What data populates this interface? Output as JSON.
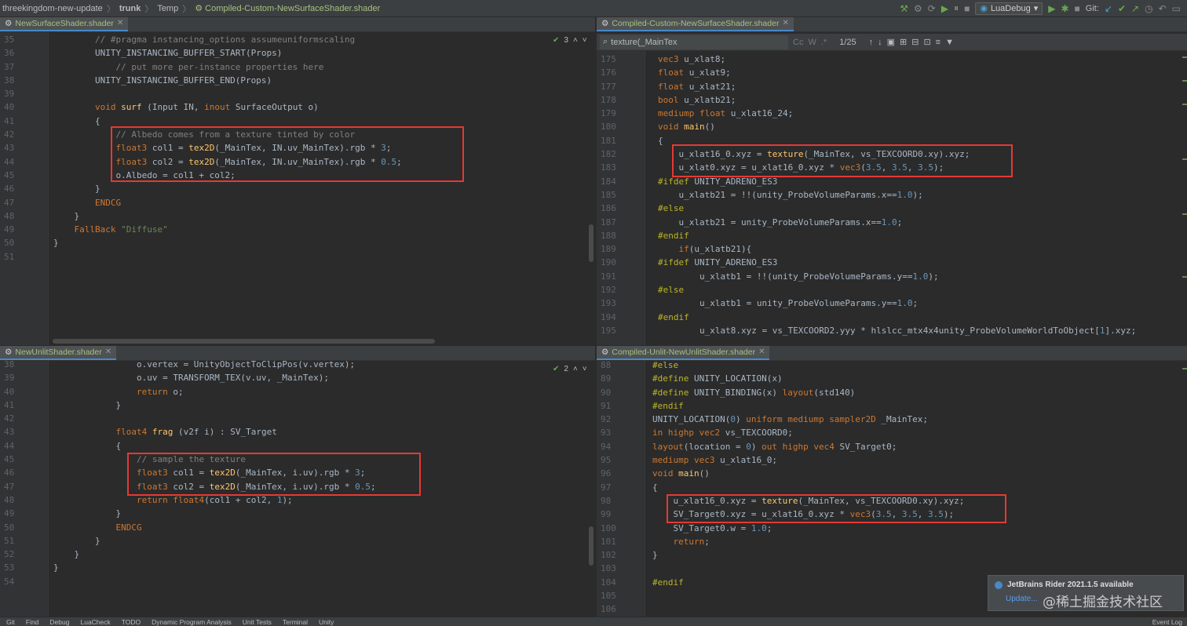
{
  "breadcrumb": [
    "threekingdom-new-update",
    "trunk",
    "Temp",
    "Compiled-Custom-NewSurfaceShader.shader"
  ],
  "toolbar": {
    "run_config": "LuaDebug",
    "git_label": "Git:"
  },
  "panes": {
    "top_left": {
      "tab": "NewSurfaceShader.shader",
      "inspection": "3",
      "lines": [
        {
          "no": "35",
          "code": "        // #pragma instancing_options assumeuniformscaling"
        },
        {
          "no": "36",
          "code": "        UNITY_INSTANCING_BUFFER_START(Props)"
        },
        {
          "no": "37",
          "code": "            // put more per-instance properties here"
        },
        {
          "no": "38",
          "code": "        UNITY_INSTANCING_BUFFER_END(Props)"
        },
        {
          "no": "39",
          "code": ""
        },
        {
          "no": "40",
          "code": "        void surf (Input IN, inout SurfaceOutput o)"
        },
        {
          "no": "41",
          "code": "        {"
        },
        {
          "no": "42",
          "code": "            // Albedo comes from a texture tinted by color"
        },
        {
          "no": "43",
          "code": "            float3 col1 = tex2D(_MainTex, IN.uv_MainTex).rgb * 3;"
        },
        {
          "no": "44",
          "code": "            float3 col2 = tex2D(_MainTex, IN.uv_MainTex).rgb * 0.5;"
        },
        {
          "no": "45",
          "code": "            o.Albedo = col1 + col2;"
        },
        {
          "no": "46",
          "code": "        }"
        },
        {
          "no": "47",
          "code": "        ENDCG"
        },
        {
          "no": "48",
          "code": "    }"
        },
        {
          "no": "49",
          "code": "    FallBack \"Diffuse\""
        },
        {
          "no": "50",
          "code": "}"
        },
        {
          "no": "51",
          "code": ""
        }
      ]
    },
    "top_right": {
      "tab": "Compiled-Custom-NewSurfaceShader.shader",
      "search_query": "texture(_MainTex",
      "match_count": "1/25",
      "lines": [
        {
          "no": "175",
          "code": "vec3 u_xlat8;"
        },
        {
          "no": "176",
          "code": "float u_xlat9;"
        },
        {
          "no": "177",
          "code": "float u_xlat21;"
        },
        {
          "no": "178",
          "code": "bool u_xlatb21;"
        },
        {
          "no": "179",
          "code": "mediump float u_xlat16_24;"
        },
        {
          "no": "180",
          "code": "void main()"
        },
        {
          "no": "181",
          "code": "{"
        },
        {
          "no": "182",
          "code": "    u_xlat16_0.xyz = texture(_MainTex, vs_TEXCOORD0.xy).xyz;"
        },
        {
          "no": "183",
          "code": "    u_xlat0.xyz = u_xlat16_0.xyz * vec3(3.5, 3.5, 3.5);"
        },
        {
          "no": "184",
          "code": "#ifdef UNITY_ADRENO_ES3"
        },
        {
          "no": "185",
          "code": "    u_xlatb21 = !!(unity_ProbeVolumeParams.x==1.0);"
        },
        {
          "no": "186",
          "code": "#else"
        },
        {
          "no": "187",
          "code": "    u_xlatb21 = unity_ProbeVolumeParams.x==1.0;"
        },
        {
          "no": "188",
          "code": "#endif"
        },
        {
          "no": "189",
          "code": "    if(u_xlatb21){"
        },
        {
          "no": "190",
          "code": "#ifdef UNITY_ADRENO_ES3"
        },
        {
          "no": "191",
          "code": "        u_xlatb1 = !!(unity_ProbeVolumeParams.y==1.0);"
        },
        {
          "no": "192",
          "code": "#else"
        },
        {
          "no": "193",
          "code": "        u_xlatb1 = unity_ProbeVolumeParams.y==1.0;"
        },
        {
          "no": "194",
          "code": "#endif"
        },
        {
          "no": "195",
          "code": "        u_xlat8.xyz = vs_TEXCOORD2.yyy * hlslcc_mtx4x4unity_ProbeVolumeWorldToObject[1].xyz;"
        }
      ]
    },
    "bottom_left": {
      "tab": "NewUnlitShader.shader",
      "inspection": "2",
      "lines": [
        {
          "no": "38",
          "code": "                o.vertex = UnityObjectToClipPos(v.vertex);"
        },
        {
          "no": "39",
          "code": "                o.uv = TRANSFORM_TEX(v.uv, _MainTex);"
        },
        {
          "no": "40",
          "code": "                return o;"
        },
        {
          "no": "41",
          "code": "            }"
        },
        {
          "no": "42",
          "code": ""
        },
        {
          "no": "43",
          "code": "            float4 frag (v2f i) : SV_Target"
        },
        {
          "no": "44",
          "code": "            {"
        },
        {
          "no": "45",
          "code": "                // sample the texture"
        },
        {
          "no": "46",
          "code": "                float3 col1 = tex2D(_MainTex, i.uv).rgb * 3;"
        },
        {
          "no": "47",
          "code": "                float3 col2 = tex2D(_MainTex, i.uv).rgb * 0.5;"
        },
        {
          "no": "48",
          "code": "                return float4(col1 + col2, 1);"
        },
        {
          "no": "49",
          "code": "            }"
        },
        {
          "no": "50",
          "code": "            ENDCG"
        },
        {
          "no": "51",
          "code": "        }"
        },
        {
          "no": "52",
          "code": "    }"
        },
        {
          "no": "53",
          "code": "}"
        },
        {
          "no": "54",
          "code": ""
        }
      ]
    },
    "bottom_right": {
      "tab": "Compiled-Unlit-NewUnlitShader.shader",
      "lines": [
        {
          "no": "88",
          "code": "#else"
        },
        {
          "no": "89",
          "code": "#define UNITY_LOCATION(x)"
        },
        {
          "no": "90",
          "code": "#define UNITY_BINDING(x) layout(std140)"
        },
        {
          "no": "91",
          "code": "#endif"
        },
        {
          "no": "92",
          "code": "UNITY_LOCATION(0) uniform mediump sampler2D _MainTex;"
        },
        {
          "no": "93",
          "code": "in highp vec2 vs_TEXCOORD0;"
        },
        {
          "no": "94",
          "code": "layout(location = 0) out highp vec4 SV_Target0;"
        },
        {
          "no": "95",
          "code": "mediump vec3 u_xlat16_0;"
        },
        {
          "no": "96",
          "code": "void main()"
        },
        {
          "no": "97",
          "code": "{"
        },
        {
          "no": "98",
          "code": "    u_xlat16_0.xyz = texture(_MainTex, vs_TEXCOORD0.xy).xyz;"
        },
        {
          "no": "99",
          "code": "    SV_Target0.xyz = u_xlat16_0.xyz * vec3(3.5, 3.5, 3.5);"
        },
        {
          "no": "100",
          "code": "    SV_Target0.w = 1.0;"
        },
        {
          "no": "101",
          "code": "    return;"
        },
        {
          "no": "102",
          "code": "}"
        },
        {
          "no": "103",
          "code": ""
        },
        {
          "no": "104",
          "code": "#endif"
        },
        {
          "no": "105",
          "code": ""
        },
        {
          "no": "106",
          "code": ""
        }
      ]
    }
  },
  "notification": {
    "title": "JetBrains Rider 2021.1.5 available",
    "action": "Update..."
  },
  "watermark": "@稀土掘金技术社区",
  "statusbar": [
    "Git",
    "Find",
    "Debug",
    "LuaCheck",
    "TODO",
    "Dynamic Program Analysis",
    "Unit Tests",
    "Terminal",
    "Unity"
  ],
  "statusbar_right": "Event Log",
  "colors": {
    "accent": "#4a88c7",
    "highlight_box": "#e53935"
  }
}
